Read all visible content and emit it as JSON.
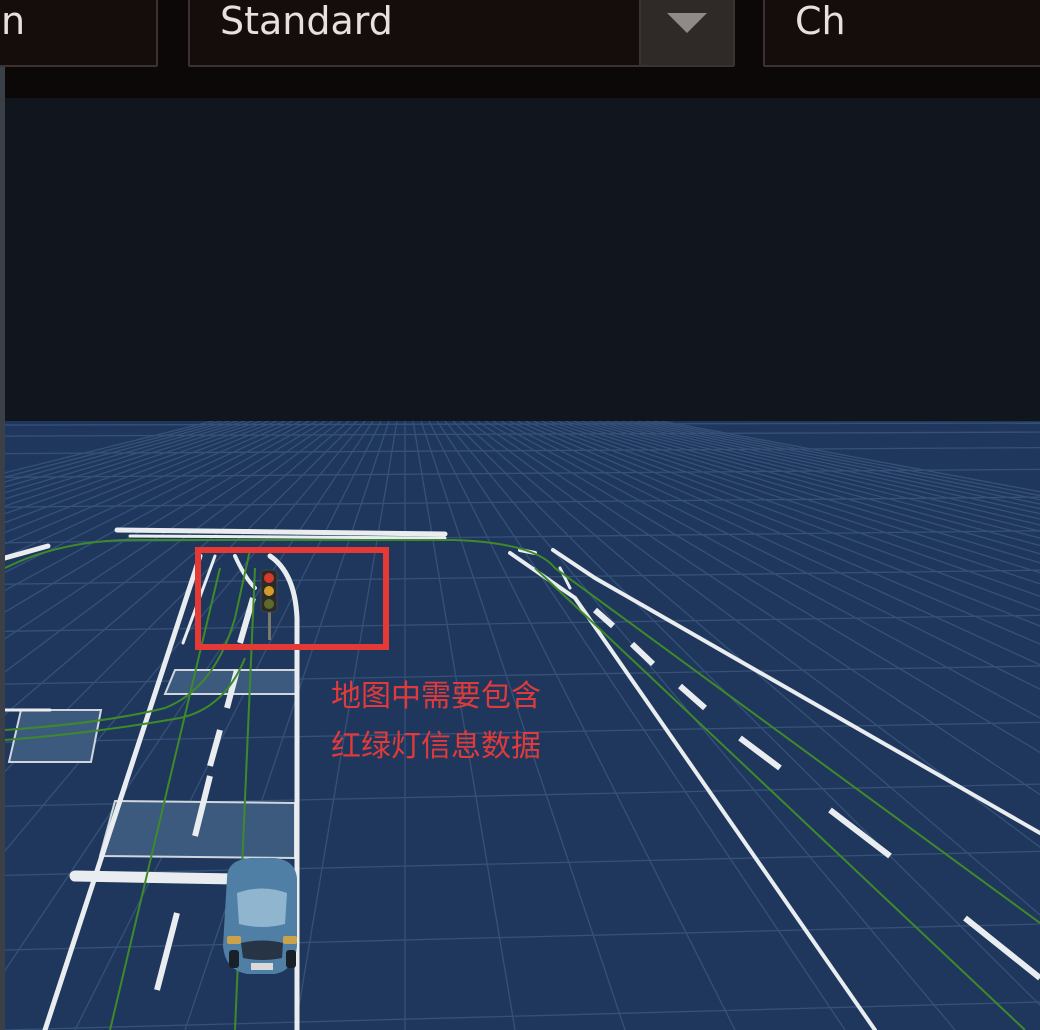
{
  "toolbar": {
    "prev_field_text": "n",
    "mode_select_value": "Standard",
    "next_field_text": "Ch"
  },
  "annotation": {
    "line1": "地图中需要包含",
    "line2": "红绿灯信息数据",
    "color": "#e03a3a"
  },
  "scene": {
    "ground_color": "#1e355a",
    "sky_color": "#11151d",
    "lane_color": "#e8ecef",
    "route_color": "#3e8a2a",
    "highlight_color": "#e53935"
  },
  "icons": {
    "dropdown": "chevron-down-icon",
    "vehicle": "car-icon",
    "traffic_light": "traffic-light-icon"
  }
}
